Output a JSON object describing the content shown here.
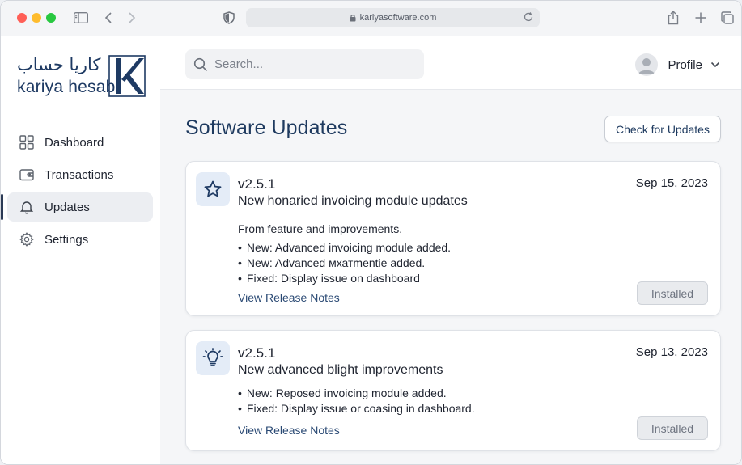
{
  "browser": {
    "url": "kariyasoftware.com"
  },
  "brand": {
    "arabic": "كاريا حساب",
    "english": "kariya hesab",
    "mark_letter": "K",
    "color": "#1e3a63"
  },
  "sidebar": {
    "items": [
      {
        "label": "Dashboard",
        "icon": "dashboard-grid-icon",
        "active": false
      },
      {
        "label": "Transactions",
        "icon": "wallet-icon",
        "active": false
      },
      {
        "label": "Updates",
        "icon": "bell-icon",
        "active": true
      },
      {
        "label": "Settings",
        "icon": "gear-icon",
        "active": false
      }
    ]
  },
  "header": {
    "search_placeholder": "Search...",
    "profile_label": "Profile"
  },
  "page": {
    "title": "Software Updates",
    "check_button": "Check for Updates"
  },
  "updates": [
    {
      "icon": "star-icon",
      "version": "v2.5.1",
      "date": "Sep 15, 2023",
      "subtitle": "New honaried invoicing module updates",
      "lead": "From feature and improvements.",
      "bullets": [
        "New: Advanced invoicing module added.",
        "New: Advanced мхатmentie added.",
        "Fixed: Display issue on dashboard"
      ],
      "link": "View Release Notes",
      "status": "Installed"
    },
    {
      "icon": "lightbulb-icon",
      "version": "v2.5.1",
      "date": "Sep 13, 2023",
      "subtitle": "New advanced blight improvements",
      "bullets": [
        "New: Reposed invoicing module added.",
        "Fixed: Display issue or coasing in dashboard."
      ],
      "link": "View Release Notes",
      "status": "Installed"
    }
  ],
  "colors": {
    "accent": "#1e3a5f",
    "link": "#2b4a74",
    "active_nav_bg": "#eceef2",
    "icon_tile_bg": "#e4ecf7"
  }
}
